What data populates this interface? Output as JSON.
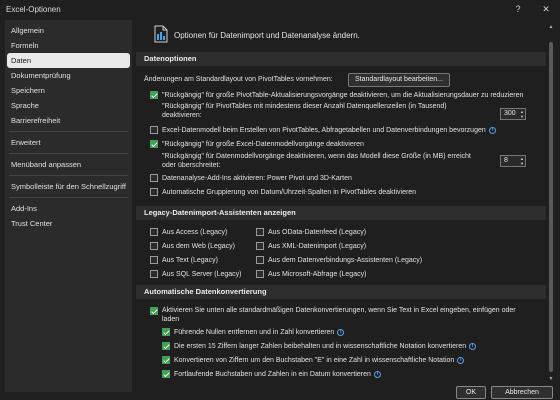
{
  "window": {
    "title": "Excel-Optionen",
    "help_glyph": "?",
    "close_glyph": "✕"
  },
  "sidebar": {
    "items": [
      {
        "label": "Allgemein"
      },
      {
        "label": "Formeln"
      },
      {
        "label": "Daten",
        "active": true
      },
      {
        "label": "Dokumentprüfung"
      },
      {
        "label": "Speichern"
      },
      {
        "label": "Sprache"
      },
      {
        "label": "Barrierefreiheit"
      },
      {
        "label": "Erweitert"
      },
      {
        "label": "Menüband anpassen"
      },
      {
        "label": "Symbolleiste für den Schnellzugriff"
      },
      {
        "label": "Add-Ins"
      },
      {
        "label": "Trust Center"
      }
    ]
  },
  "header": {
    "text": "Optionen für Datenimport und Datenanalyse ändern."
  },
  "sections": {
    "data_options": "Datenoptionen",
    "legacy": "Legacy-Datenimport-Assistenten anzeigen",
    "auto_conversion": "Automatische Datenkonvertierung"
  },
  "data_options": {
    "layout_label": "Änderungen am Standardlayout von PivotTables vornehmen:",
    "layout_button": "Standardlayout bearbeiten...",
    "undo_pivot": "\"Rückgängig\" für große PivotTable-Aktualisierungsvorgänge deaktivieren, um die Aktualisierungsdauer zu reduzieren",
    "undo_pivot_note_1": "\"Rückgängig\" für PivotTables mit mindestens dieser Anzahl Datenquellenzeilen (in Tausend)",
    "undo_pivot_note_2": "deaktivieren:",
    "undo_pivot_value": "300",
    "excel_datamodel": "Excel-Datenmodell beim Erstellen von PivotTables, Abfragetabellen und Datenverbindungen bevorzugen",
    "undo_model": "\"Rückgängig\" für große Excel-Datenmodellvorgänge deaktivieren",
    "undo_model_note_1": "\"Rückgängig\" für Datenmodellvorgänge deaktivieren, wenn das Modell diese Größe (in MB) erreicht",
    "undo_model_note_2": "oder überschreitet:",
    "undo_model_value": "8",
    "addins": "Datenanalyse-Add-Ins aktivieren: Power Pivot und 3D-Karten",
    "auto_group": "Automatische Gruppierung von Datum/Uhrzeit-Spalten in PivotTables deaktivieren"
  },
  "legacy": {
    "access": "Aus Access (Legacy)",
    "web": "Aus dem Web (Legacy)",
    "text": "Aus Text (Legacy)",
    "sql": "Aus SQL Server (Legacy)",
    "odata": "Aus OData-Datenfeed (Legacy)",
    "xml": "Aus XML-Datenimport (Legacy)",
    "dcw": "Aus dem Datenverbindungs-Assistenten (Legacy)",
    "msquery": "Aus Microsoft-Abfrage (Legacy)"
  },
  "auto_conversion": {
    "enable_all_1": "Aktivieren Sie unten alle standardmäßigen Datenkonvertierungen, wenn Sie Text in Excel eingeben, einfügen oder",
    "enable_all_2": "laden",
    "leading_zeros": "Führende Nullen entfernen und in Zahl konvertieren",
    "first15": "Die ersten 15 Ziffern langer Zahlen beibehalten und in wissenschaftliche Notation konvertieren",
    "e_convert": "Konvertieren von Ziffern um den Buchstaben \"E\" in eine Zahl in wissenschaftliche Notation",
    "continuous": "Fortlaufende Buchstaben und Zahlen in ein Datum konvertieren"
  },
  "footer": {
    "ok": "OK",
    "cancel": "Abbrechen"
  },
  "colors": {
    "checkbox_checked": "#3fa155",
    "info_icon": "#5aa0e6",
    "background": "#1f1f1f",
    "sidebar": "#2b2b2b"
  }
}
